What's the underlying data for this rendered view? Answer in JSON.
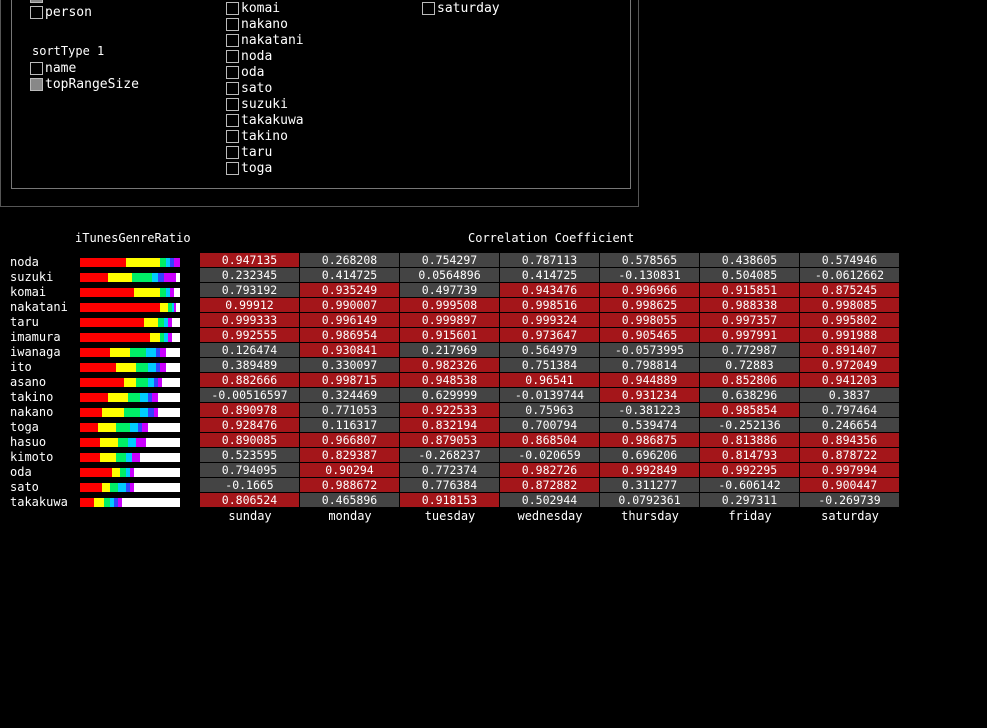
{
  "settings": {
    "col1": [
      {
        "label": "week",
        "checked": true
      },
      {
        "label": "person",
        "checked": false
      }
    ],
    "sort_label": "sortType 1",
    "sort_options": [
      {
        "label": "name",
        "checked": false
      },
      {
        "label": "topRangeSize",
        "checked": true
      }
    ],
    "people": [
      {
        "label": "komai",
        "checked": false
      },
      {
        "label": "nakano",
        "checked": false
      },
      {
        "label": "nakatani",
        "checked": false
      },
      {
        "label": "noda",
        "checked": false
      },
      {
        "label": "oda",
        "checked": false
      },
      {
        "label": "sato",
        "checked": false
      },
      {
        "label": "suzuki",
        "checked": false
      },
      {
        "label": "takakuwa",
        "checked": false
      },
      {
        "label": "takino",
        "checked": false
      },
      {
        "label": "taru",
        "checked": false
      },
      {
        "label": "toga",
        "checked": false
      }
    ],
    "days_col": [
      {
        "label": "saturday",
        "checked": false
      }
    ]
  },
  "ratio_title": "iTunesGenreRatio",
  "corr_title": "Correlation Coefficient",
  "colors": {
    "highlight": "#a4161a",
    "normal": "#444444"
  },
  "genre_colors": [
    "#ff0000",
    "#ffff00",
    "#aaff00",
    "#00ee66",
    "#00ccff",
    "#3344ff",
    "#cc00ff",
    "#ffffff"
  ],
  "days": [
    "sunday",
    "monday",
    "tuesday",
    "wednesday",
    "thursday",
    "friday",
    "saturday"
  ],
  "rows": [
    {
      "name": "noda",
      "bar": [
        0.46,
        0.34,
        0,
        0.06,
        0.04,
        0.04,
        0.06,
        0
      ],
      "vals": [
        "0.947135",
        "0.268208",
        "0.754297",
        "0.787113",
        "0.578565",
        "0.438605",
        "0.574946"
      ],
      "hl": [
        1,
        0,
        0,
        0,
        0,
        0,
        0
      ]
    },
    {
      "name": "suzuki",
      "bar": [
        0.28,
        0.24,
        0,
        0.2,
        0.06,
        0.06,
        0.12,
        0.04
      ],
      "vals": [
        "0.232345",
        "0.414725",
        "0.0564896",
        "0.414725",
        "-0.130831",
        "0.504085",
        "-0.0612662"
      ],
      "hl": [
        0,
        0,
        0,
        0,
        0,
        0,
        0
      ]
    },
    {
      "name": "komai",
      "bar": [
        0.54,
        0.26,
        0,
        0.06,
        0.04,
        0,
        0.04,
        0.06
      ],
      "vals": [
        "0.793192",
        "0.935249",
        "0.497739",
        "0.943476",
        "0.996966",
        "0.915851",
        "0.875245"
      ],
      "hl": [
        0,
        1,
        0,
        1,
        1,
        1,
        1
      ]
    },
    {
      "name": "nakatani",
      "bar": [
        0.8,
        0.08,
        0,
        0.04,
        0.02,
        0,
        0.02,
        0.04
      ],
      "vals": [
        "0.99912",
        "0.990007",
        "0.999508",
        "0.998516",
        "0.998625",
        "0.988338",
        "0.998085"
      ],
      "hl": [
        1,
        1,
        1,
        1,
        1,
        1,
        1
      ]
    },
    {
      "name": "taru",
      "bar": [
        0.64,
        0.14,
        0,
        0.06,
        0.04,
        0,
        0.04,
        0.08
      ],
      "vals": [
        "0.999333",
        "0.996149",
        "0.999897",
        "0.999324",
        "0.998055",
        "0.997357",
        "0.995802"
      ],
      "hl": [
        1,
        1,
        1,
        1,
        1,
        1,
        1
      ]
    },
    {
      "name": "imamura",
      "bar": [
        0.7,
        0.1,
        0,
        0.04,
        0.04,
        0,
        0.04,
        0.08
      ],
      "vals": [
        "0.992555",
        "0.986954",
        "0.915601",
        "0.973647",
        "0.905465",
        "0.997991",
        "0.991988"
      ],
      "hl": [
        1,
        1,
        1,
        1,
        1,
        1,
        1
      ]
    },
    {
      "name": "iwanaga",
      "bar": [
        0.3,
        0.2,
        0,
        0.16,
        0.1,
        0.04,
        0.06,
        0.14
      ],
      "vals": [
        "0.126474",
        "0.930841",
        "0.217969",
        "0.564979",
        "-0.0573995",
        "0.772987",
        "0.891407"
      ],
      "hl": [
        0,
        1,
        0,
        0,
        0,
        0,
        1
      ]
    },
    {
      "name": "ito",
      "bar": [
        0.36,
        0.2,
        0,
        0.12,
        0.08,
        0.04,
        0.06,
        0.14
      ],
      "vals": [
        "0.389489",
        "0.330097",
        "0.982326",
        "0.751384",
        "0.798814",
        "0.72883",
        "0.972049"
      ],
      "hl": [
        0,
        0,
        1,
        0,
        0,
        0,
        1
      ]
    },
    {
      "name": "asano",
      "bar": [
        0.44,
        0.12,
        0,
        0.12,
        0.06,
        0.04,
        0.04,
        0.18
      ],
      "vals": [
        "0.882666",
        "0.998715",
        "0.948538",
        "0.96541",
        "0.944889",
        "0.852806",
        "0.941203"
      ],
      "hl": [
        1,
        1,
        1,
        1,
        1,
        1,
        1
      ]
    },
    {
      "name": "takino",
      "bar": [
        0.28,
        0.2,
        0,
        0.12,
        0.08,
        0.04,
        0.06,
        0.22
      ],
      "vals": [
        "-0.00516597",
        "0.324469",
        "0.629999",
        "-0.0139744",
        "0.931234",
        "0.638296",
        "0.3837"
      ],
      "hl": [
        0,
        0,
        0,
        0,
        1,
        0,
        0
      ]
    },
    {
      "name": "nakano",
      "bar": [
        0.22,
        0.22,
        0,
        0.16,
        0.08,
        0.06,
        0.04,
        0.22
      ],
      "vals": [
        "0.890978",
        "0.771053",
        "0.922533",
        "0.75963",
        "-0.381223",
        "0.985854",
        "0.797464"
      ],
      "hl": [
        1,
        0,
        1,
        0,
        0,
        1,
        0
      ]
    },
    {
      "name": "toga",
      "bar": [
        0.18,
        0.18,
        0,
        0.14,
        0.08,
        0.04,
        0.06,
        0.32
      ],
      "vals": [
        "0.928476",
        "0.116317",
        "0.832194",
        "0.700794",
        "0.539474",
        "-0.252136",
        "0.246654"
      ],
      "hl": [
        1,
        0,
        1,
        0,
        0,
        0,
        0
      ]
    },
    {
      "name": "hasuo",
      "bar": [
        0.2,
        0.18,
        0,
        0.1,
        0.08,
        0,
        0.1,
        0.34
      ],
      "vals": [
        "0.890085",
        "0.966807",
        "0.879053",
        "0.868504",
        "0.986875",
        "0.813886",
        "0.894356"
      ],
      "hl": [
        1,
        1,
        1,
        1,
        1,
        1,
        1
      ]
    },
    {
      "name": "kimoto",
      "bar": [
        0.2,
        0.16,
        0,
        0.1,
        0.06,
        0,
        0.08,
        0.4
      ],
      "vals": [
        "0.523595",
        "0.829387",
        "-0.268237",
        "-0.020659",
        "0.696206",
        "0.814793",
        "0.878722"
      ],
      "hl": [
        0,
        1,
        0,
        0,
        0,
        1,
        1
      ]
    },
    {
      "name": "oda",
      "bar": [
        0.32,
        0.08,
        0,
        0.06,
        0.04,
        0,
        0.04,
        0.46
      ],
      "vals": [
        "0.794095",
        "0.90294",
        "0.772374",
        "0.982726",
        "0.992849",
        "0.992295",
        "0.997994"
      ],
      "hl": [
        0,
        1,
        0,
        1,
        1,
        1,
        1
      ]
    },
    {
      "name": "sato",
      "bar": [
        0.22,
        0.08,
        0,
        0.08,
        0.08,
        0.04,
        0.04,
        0.46
      ],
      "vals": [
        "-0.1665",
        "0.988672",
        "0.776384",
        "0.872882",
        "0.311277",
        "-0.606142",
        "0.900447"
      ],
      "hl": [
        0,
        1,
        0,
        1,
        0,
        0,
        1
      ]
    },
    {
      "name": "takakuwa",
      "bar": [
        0.14,
        0.1,
        0,
        0.06,
        0.04,
        0.04,
        0.04,
        0.58
      ],
      "vals": [
        "0.806524",
        "0.465896",
        "0.918153",
        "0.502944",
        "0.0792361",
        "0.297311",
        "-0.269739"
      ],
      "hl": [
        1,
        0,
        1,
        0,
        0,
        0,
        0
      ]
    }
  ]
}
